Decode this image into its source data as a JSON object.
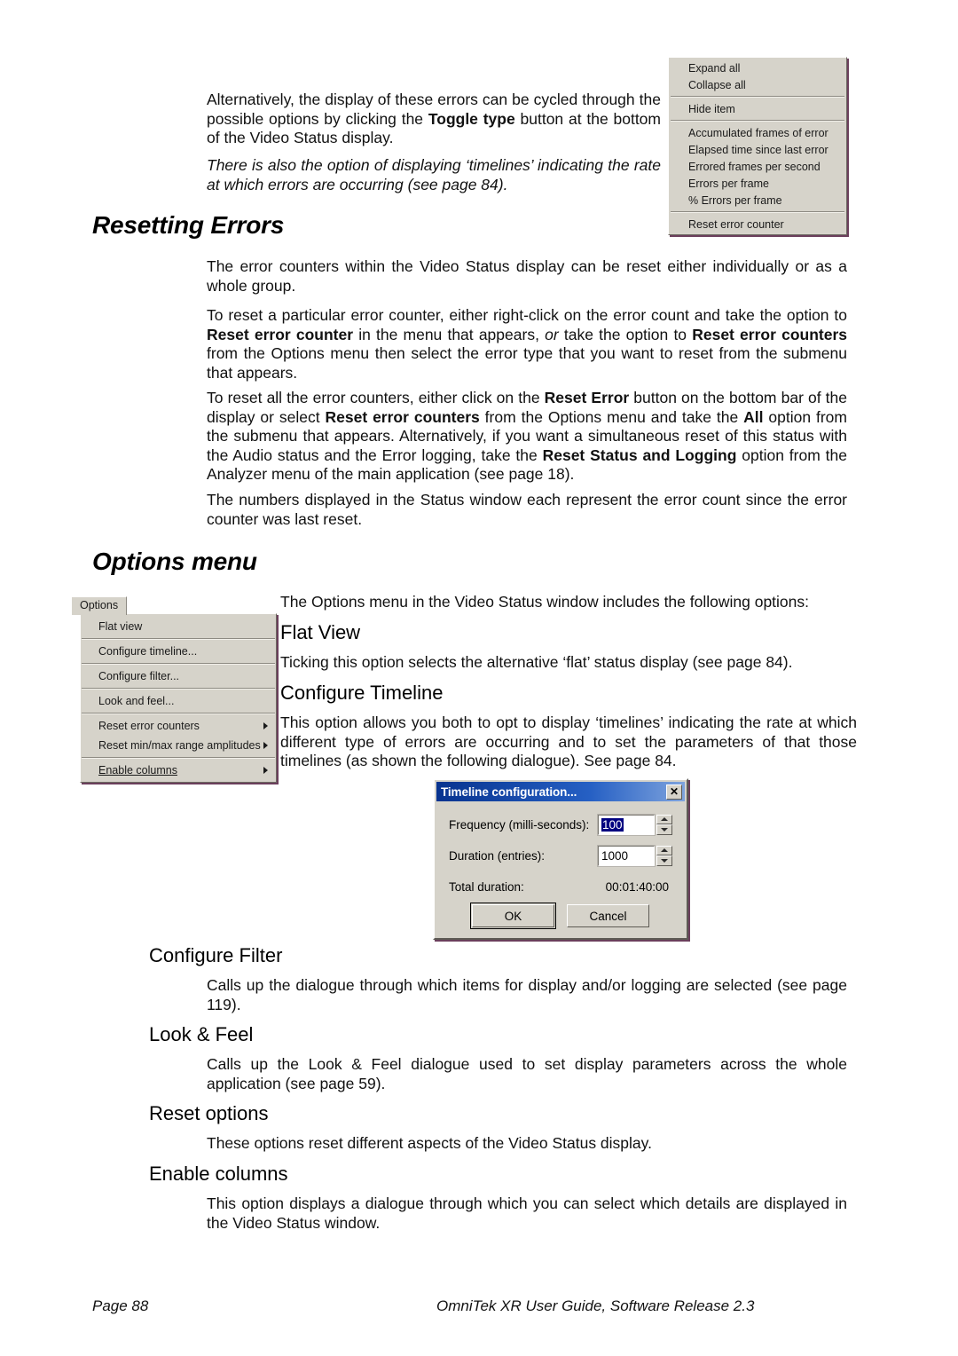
{
  "document": {
    "page_label": "Page 88",
    "footer_right": "OmniTek XR User Guide, Software Release 2.3"
  },
  "intro": {
    "paragraph_1_part1": "Alternatively, the display of these errors can be cycled through the possible options by clicking the ",
    "paragraph_1_bold": "Toggle type",
    "paragraph_1_part2": " button at the bottom of the Video Status display.",
    "paragraph_2_italic": "There is also the option of displaying ‘timelines’ indicating the rate at which errors are occurring (see page 84)."
  },
  "context_menu": {
    "items": [
      "Expand all",
      "Collapse all",
      "Hide item",
      "Accumulated frames of error",
      "Elapsed time since last error",
      "Errored frames per second",
      "Errors per frame",
      "% Errors per frame",
      "Reset error counter"
    ]
  },
  "resetting_errors": {
    "heading": "Resetting Errors",
    "p1": "The error counters within the Video Status display can be reset either individually or as a whole group.",
    "p2_a": "To reset a particular error counter, either right-click on the error count and take the option to ",
    "p2_b_bold": "Reset error counter",
    "p2_c": " in the menu that appears, ",
    "p2_d_italic": "or",
    "p2_e": " take the option to ",
    "p2_f_bold": "Reset error counters",
    "p2_g": " from the Options menu then select the error type that you want to reset from the submenu that appears.",
    "p3_a": "To reset all the error counters, either click on the ",
    "p3_b_bold": "Reset Error",
    "p3_c": " button on the bottom bar of the display or select ",
    "p3_d_bold": "Reset error counters",
    "p3_e": " from the Options menu and take the ",
    "p3_f_bold": "All",
    "p3_g": " option from the submenu that appears. Alternatively, if you want a simultaneous reset of this status with the Audio status and the Error logging, take the ",
    "p3_h_bold": "Reset Status and Logging",
    "p3_i": " option from the Analyzer menu of the main application (see page 18).",
    "p4": "The numbers displayed in the Status window each represent the error count since the error counter was last reset."
  },
  "options_menu_section": {
    "heading": "Options menu",
    "intro": "The Options menu in the Video Status window includes the following options:",
    "menu_graphic": {
      "tab_label": "Options",
      "items": [
        {
          "label": "Flat view",
          "submenu": false
        },
        {
          "label": "Configure timeline...",
          "submenu": false
        },
        {
          "label": "Configure filter...",
          "submenu": false
        },
        {
          "label": "Look and feel...",
          "submenu": false
        },
        {
          "label": "Reset error counters",
          "submenu": true
        },
        {
          "label": "Reset min/max range amplitudes",
          "submenu": true
        },
        {
          "label": "Enable columns",
          "submenu": true
        }
      ]
    },
    "subsections": [
      {
        "heading": "Flat View",
        "body": "Ticking this option selects the alternative ‘flat’ status display (see page 84)."
      },
      {
        "heading": "Configure Timeline",
        "body": "This option allows you both to opt to display ‘timelines’ indicating the rate at which different type of errors are occurring and to set the parameters of that those timelines (as shown the following dialogue). See page 84."
      },
      {
        "heading": "Configure Filter",
        "body": "Calls up the dialogue through which items for display and/or logging are selected (see page 119)."
      },
      {
        "heading": "Look & Feel",
        "body": "Calls up the Look & Feel dialogue used to set display parameters across the whole application (see page 59)."
      },
      {
        "heading": "Reset options",
        "body": "These options reset different aspects of the Video Status display."
      },
      {
        "heading": "Enable columns",
        "body": "This option displays a dialogue through which you can select which details are displayed in the Video Status window."
      }
    ]
  },
  "timeline_dialog": {
    "title": "Timeline configuration...",
    "close_label": "✕",
    "frequency_label": "Frequency (milli-seconds):",
    "frequency_value": "100",
    "duration_label": "Duration (entries):",
    "duration_value": "1000",
    "total_duration_label": "Total duration:",
    "total_duration_value": "00:01:40:00",
    "ok_label": "OK",
    "cancel_label": "Cancel"
  },
  "colors": {
    "menu_face": "#d6d3ca",
    "title_bar_start": "#07338f",
    "title_bar_end": "#7ea3dd",
    "selection": "#000080",
    "shadow": "#6b3f5c"
  }
}
